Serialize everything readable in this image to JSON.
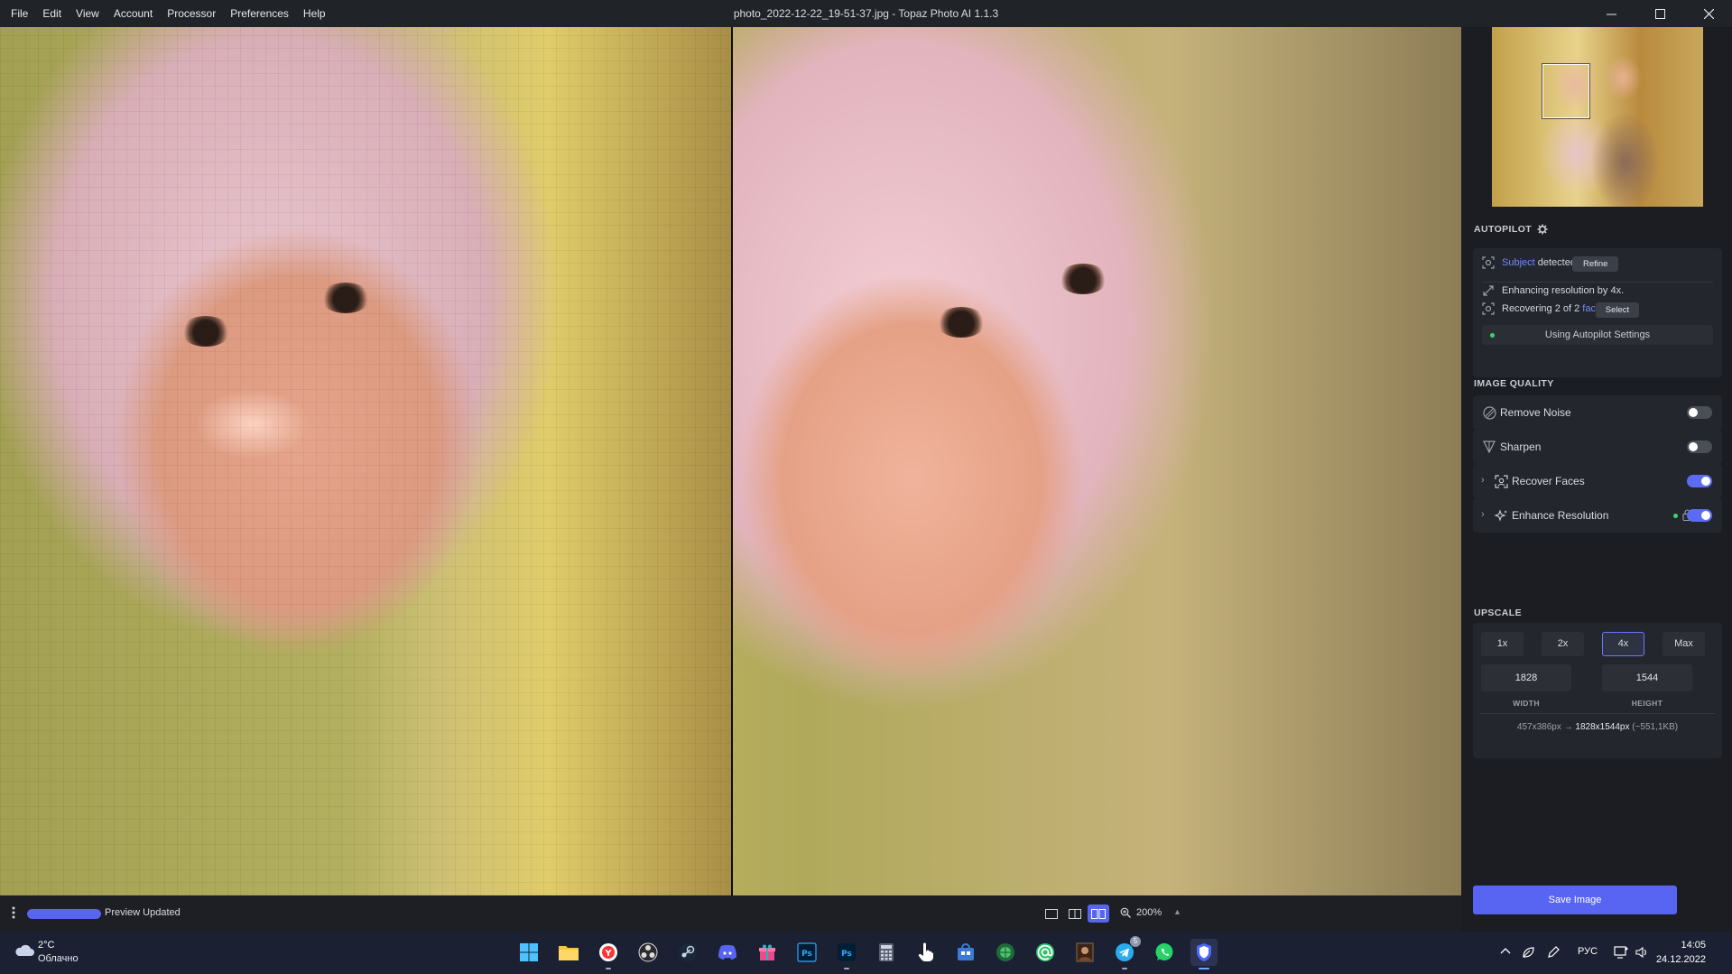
{
  "menu": [
    "File",
    "Edit",
    "View",
    "Account",
    "Processor",
    "Preferences",
    "Help"
  ],
  "window_title": "photo_2022-12-22_19-51-37.jpg - Topaz Photo AI 1.1.3",
  "autopilot": {
    "title": "AUTOPILOT",
    "subject_link": "Subject",
    "subject_rest": " detected.",
    "refine_label": "Refine",
    "enhancing_text": "Enhancing resolution by 4x.",
    "recovering_prefix": "Recovering 2 of 2 ",
    "faces_link": "faces",
    "recovering_suffix": ".",
    "select_label": "Select",
    "settings_label": "Using Autopilot Settings"
  },
  "image_quality": {
    "title": "IMAGE QUALITY",
    "items": [
      {
        "label": "Remove Noise",
        "enabled": false
      },
      {
        "label": "Sharpen",
        "enabled": false
      },
      {
        "label": "Recover Faces",
        "enabled": true
      },
      {
        "label": "Enhance Resolution",
        "enabled": true
      }
    ]
  },
  "upscale": {
    "title": "UPSCALE",
    "options": [
      "1x",
      "2x",
      "4x",
      "Max"
    ],
    "selected": "4x",
    "width": "1828",
    "height": "1544",
    "width_label": "WIDTH",
    "height_label": "HEIGHT",
    "from_dims": "457x386px → ",
    "to_dims": "1828x1544px",
    "size_note": " (~551,1KB)"
  },
  "save_label": "Save Image",
  "status": {
    "text": "Preview Updated",
    "progress": 1.0,
    "zoom": "200%"
  },
  "taskbar": {
    "weather_temp": "2°C",
    "weather_desc": "Облачно",
    "apps": [
      "windows-start",
      "file-explorer",
      "yandex-browser",
      "obs-studio",
      "steam",
      "discord",
      "gift-app",
      "photoshop-old",
      "photoshop",
      "calculator",
      "pointer-app",
      "store-app",
      "vpn-app",
      "mail-app",
      "portrait-app",
      "telegram",
      "whatsapp",
      "topaz-photo-ai"
    ],
    "telegram_badge": "5",
    "lang": "РУС",
    "time": "14:05",
    "date": "24.12.2022"
  },
  "colors": {
    "accent": "#5865f2",
    "link": "#6f8cff",
    "status_green": "#3fd36b"
  }
}
